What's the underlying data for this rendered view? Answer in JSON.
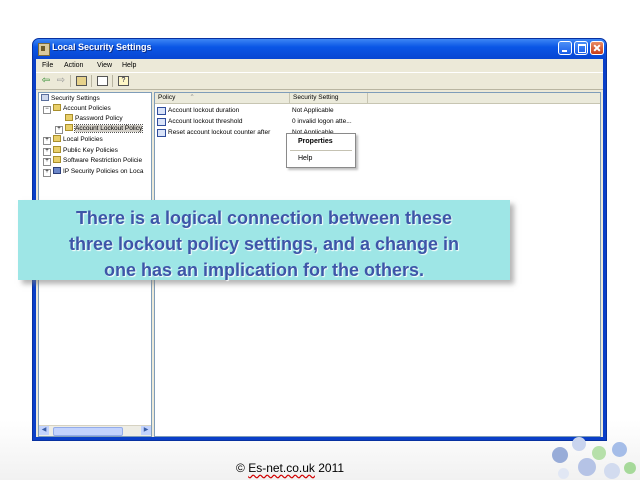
{
  "window": {
    "title": "Local Security Settings"
  },
  "menubar": [
    "File",
    "Action",
    "View",
    "Help"
  ],
  "toolbar": {
    "icons": [
      "back-arrow-icon",
      "forward-arrow-icon",
      "up-folder-icon",
      "show-hide-tree-icon",
      "help-icon"
    ]
  },
  "tree": {
    "items": [
      {
        "label": "Security Settings",
        "icon": "security-settings-icon"
      },
      {
        "label": "Account Policies",
        "icon": "folder-icon"
      },
      {
        "label": "Password Policy",
        "icon": "folder-icon"
      },
      {
        "label": "Account Lockout Policy",
        "icon": "folder-icon"
      },
      {
        "label": "Local Policies",
        "icon": "folder-icon"
      },
      {
        "label": "Public Key Policies",
        "icon": "folder-icon"
      },
      {
        "label": "Software Restriction Policie",
        "icon": "folder-icon"
      },
      {
        "label": "IP Security Policies on Loca",
        "icon": "ip-security-icon"
      }
    ]
  },
  "list": {
    "columns": [
      "Policy",
      "Security Setting"
    ],
    "rows": [
      {
        "policy": "Account lockout duration",
        "setting": "Not Applicable"
      },
      {
        "policy": "Account lockout threshold",
        "setting": "0 invalid logon atte..."
      },
      {
        "policy": "Reset account lockout counter after",
        "setting": "Not Applicable"
      }
    ]
  },
  "context_menu": {
    "items": [
      "Properties",
      "Help"
    ]
  },
  "callout": {
    "line1": "There is a logical connection between these",
    "line2": "three lockout policy settings, and a change in",
    "line3": "one has an implication for the others."
  },
  "footer": {
    "copyright": "©",
    "brand": "Es-net.co.uk",
    "year": "2011"
  },
  "colors": {
    "titlebar": "#0a56e6",
    "callout_bg": "#9ee6e6",
    "callout_text": "#3d56a8"
  }
}
